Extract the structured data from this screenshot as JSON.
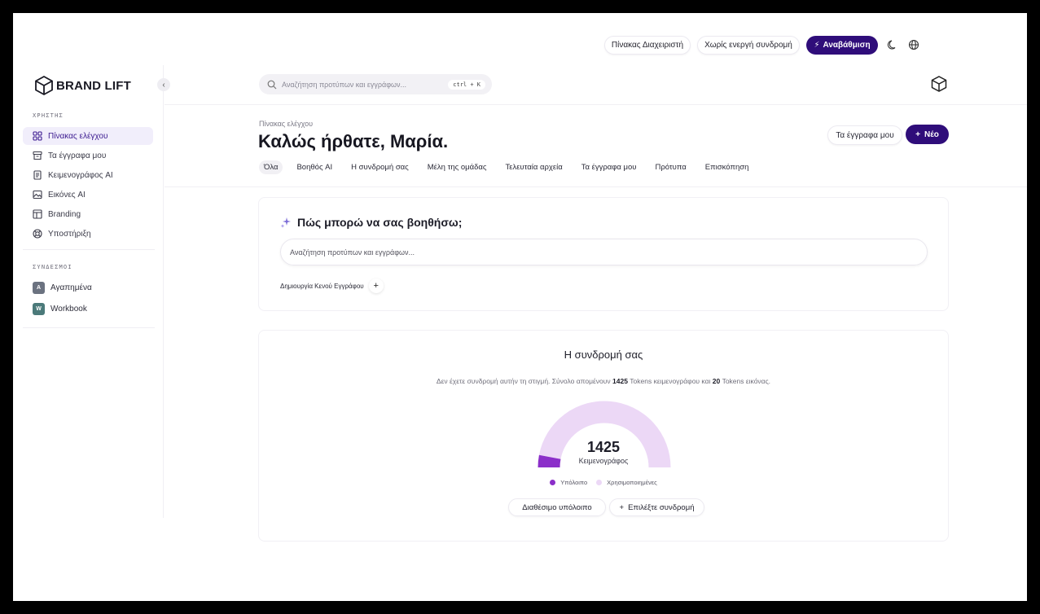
{
  "brand": {
    "name": "BRAND LIFT"
  },
  "sidebar": {
    "section_user": "ΧΡΗΣΤΗΣ",
    "items": [
      {
        "label": "Πίνακας ελέγχου",
        "icon": "grid-icon"
      },
      {
        "label": "Τα έγγραφα μου",
        "icon": "archive-icon"
      },
      {
        "label": "Κειμενογράφος AI",
        "icon": "document-icon"
      },
      {
        "label": "Εικόνες AI",
        "icon": "image-icon"
      },
      {
        "label": "Branding",
        "icon": "layout-icon"
      },
      {
        "label": "Υποστήριξη",
        "icon": "lifebuoy-icon"
      }
    ],
    "section_links": "ΣΥΝΔΕΣΜΟΙ",
    "links": [
      {
        "letter": "A",
        "label": "Αγαπημένα",
        "color": "#6b7280"
      },
      {
        "letter": "W",
        "label": "Workbook",
        "color": "#4b7a7a"
      }
    ]
  },
  "topbar": {
    "search_placeholder": "Αναζήτηση προτύπων και εγγράφων...",
    "shortcut": "ctrl + K",
    "admin_panel": "Πίνακας Διαχειριστή",
    "no_subscription": "Χωρίς ενεργή συνδρομή",
    "upgrade": "Αναβάθμιση"
  },
  "header": {
    "breadcrumb": "Πίνακας ελέγχου",
    "title": "Καλώς ήρθατε, Μαρία.",
    "my_docs_button": "Τα έγγραφα μου",
    "new_button": "Νέο",
    "tabs": [
      "Όλα",
      "Βοηθός AI",
      "Η συνδρομή σας",
      "Μέλη της ομάδας",
      "Τελευταία αρχεία",
      "Τα έγγραφα μου",
      "Πρότυπα",
      "Επισκόπηση"
    ]
  },
  "help": {
    "title": "Πώς μπορώ να σας βοηθήσω;",
    "search_placeholder": "Αναζήτηση προτύπων και εγγράφων...",
    "blank_doc": "Δημιουργία Κενού Εγγράφου"
  },
  "subscription": {
    "title": "Η συνδρομή σας",
    "desc_pre": "Δεν έχετε συνδρομή αυτήν τη στιγμή. Σύνολο απομένουν ",
    "text_tokens": "1425",
    "desc_mid": " Tokens κειμενογράφου και ",
    "image_tokens": "20",
    "desc_post": " Tokens εικόνας.",
    "gauge_value": "1425",
    "gauge_label": "Κειμενογράφος",
    "remaining_fraction": 0.06,
    "legend_remaining": "Υπόλοιπο",
    "legend_used": "Χρησιμοποιημένες",
    "color_remaining": "#8b2fc9",
    "color_used": "#ecd8f6",
    "available_button": "Διαθέσιμο υπόλοιπο",
    "choose_button": "Επιλέξτε συνδρομή"
  },
  "colors": {
    "accent": "#2f0d7a",
    "active_bg": "#f1eefb"
  }
}
